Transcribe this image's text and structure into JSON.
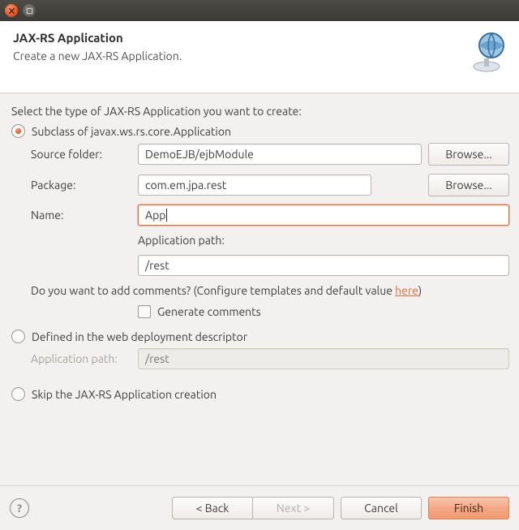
{
  "header": {
    "title": "JAX-RS Application",
    "subtitle": "Create a new JAX-RS Application."
  },
  "prompt": "Select the type of JAX-RS Application you want to create:",
  "option_subclass": "Subclass of javax.ws.rs.core.Application",
  "option_webxml": "Defined in the web deployment descriptor",
  "option_skip": "Skip the JAX-RS Application creation",
  "form": {
    "source_folder_label": "Source folder:",
    "source_folder_value": "DemoEJB/ejbModule",
    "package_label": "Package:",
    "package_value": "com.em.jpa.rest",
    "name_label": "Name:",
    "name_value": "App",
    "app_path_label": "Application path:",
    "app_path_value": "/rest",
    "browse": "Browse..."
  },
  "comments_line_prefix": "Do you want to add comments? (Configure templates and default value ",
  "comments_link": "here",
  "comments_line_suffix": ")",
  "generate_comments_label": "Generate comments",
  "webxml": {
    "app_path_label": "Application path:",
    "app_path_placeholder": "/rest"
  },
  "footer": {
    "back": "< Back",
    "next": "Next >",
    "cancel": "Cancel",
    "finish": "Finish"
  }
}
